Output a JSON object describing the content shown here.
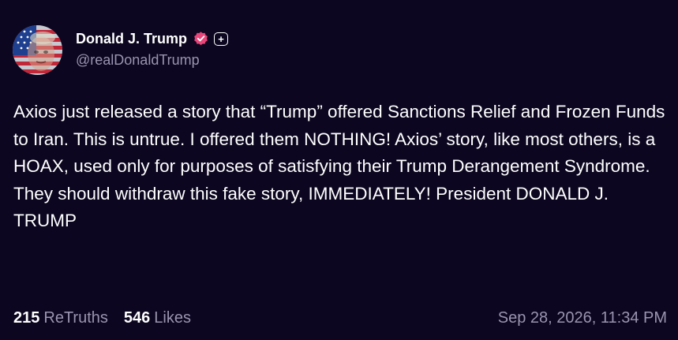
{
  "post": {
    "author": {
      "display_name": "Donald J. Trump",
      "handle": "@realDonaldTrump",
      "verified_icon": "verified-badge-icon",
      "plus_badge": "+",
      "avatar_icon": "flag-portrait-avatar"
    },
    "content": "Axios just released a story that “Trump” offered Sanctions Relief and Frozen Funds to Iran. This is untrue. I offered them NOTHING! Axios’ story, like most others, is a HOAX, used only for purposes of satisfying their Trump Derangement Syndrome. They should withdraw this fake story, IMMEDIATELY! President DONALD J. TRUMP",
    "stats": {
      "retruths_count": "215",
      "retruths_label": "ReTruths",
      "likes_count": "546",
      "likes_label": "Likes"
    },
    "timestamp": "Sep 28, 2026, 11:34 PM"
  },
  "colors": {
    "background": "#0d0620",
    "text": "#ffffff",
    "muted": "#9a94b0",
    "verified": "#e8457a"
  }
}
